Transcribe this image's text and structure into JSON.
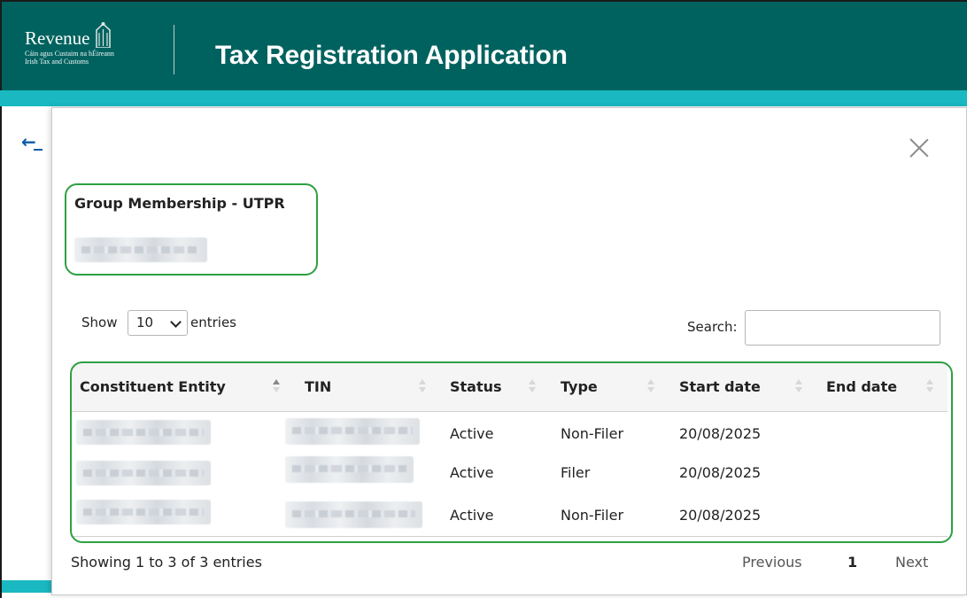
{
  "header": {
    "logo_name": "Revenue",
    "logo_sub1": "Cáin agus Custaim na hÉireann",
    "logo_sub2": "Irish Tax and Customs",
    "app_title": "Tax Registration Application"
  },
  "nav": {
    "back_arrow": "←"
  },
  "modal": {
    "title": "Group Membership - UTPR",
    "length_control": {
      "show_label": "Show",
      "selected": "10",
      "entries_label": "entries"
    },
    "search": {
      "label": "Search:",
      "value": ""
    },
    "table": {
      "columns": [
        "Constituent Entity",
        "TIN",
        "Status",
        "Type",
        "Start date",
        "End date"
      ],
      "rows": [
        {
          "constituent_entity": "",
          "tin": "",
          "status": "Active",
          "type": "Non-Filer",
          "start_date": "20/08/2025",
          "end_date": ""
        },
        {
          "constituent_entity": "",
          "tin": "",
          "status": "Active",
          "type": "Filer",
          "start_date": "20/08/2025",
          "end_date": ""
        },
        {
          "constituent_entity": "",
          "tin": "",
          "status": "Active",
          "type": "Non-Filer",
          "start_date": "20/08/2025",
          "end_date": ""
        }
      ]
    },
    "info": "Showing 1 to 3 of 3 entries",
    "pagination": {
      "previous": "Previous",
      "current": "1",
      "next": "Next"
    }
  },
  "colors": {
    "header_bg": "#00625f",
    "accent_strip": "#1ab8c0",
    "highlight": "#2ea043",
    "link": "#0d5aa7"
  }
}
